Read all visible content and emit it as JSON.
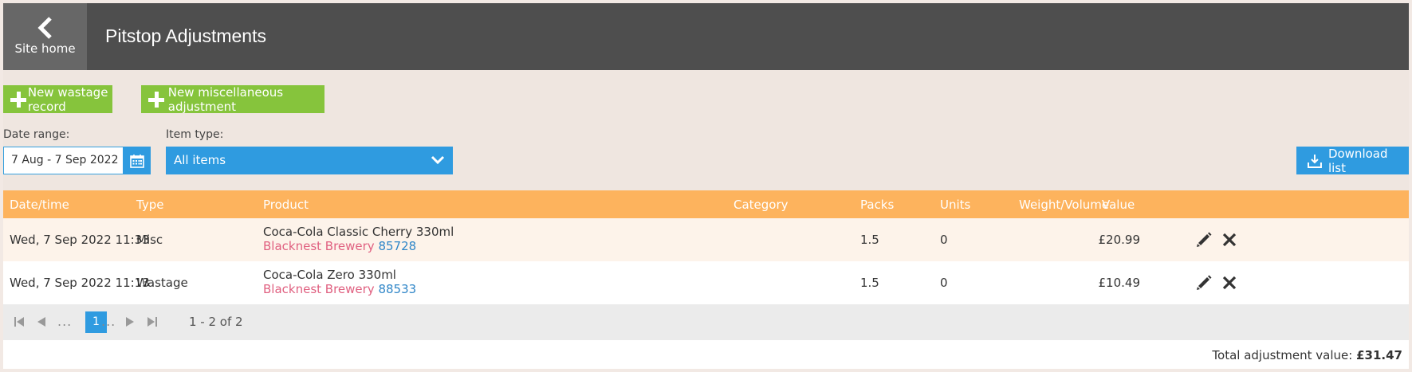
{
  "header": {
    "home_label": "Site home",
    "title": "Pitstop Adjustments"
  },
  "actions": {
    "new_wastage": "New wastage record",
    "new_misc": "New miscellaneous adjustment",
    "download": "Download list"
  },
  "filters": {
    "date_label": "Date range:",
    "date_value": "7 Aug - 7 Sep 2022",
    "type_label": "Item type:",
    "type_value": "All items"
  },
  "table": {
    "columns": [
      "Date/time",
      "Type",
      "Product",
      "Category",
      "Packs",
      "Units",
      "Weight/Volume",
      "Value"
    ],
    "rows": [
      {
        "datetime": "Wed, 7 Sep 2022 11:33",
        "type": "Misc",
        "product": "Coca-Cola Classic Cherry 330ml",
        "supplier": "Blacknest Brewery",
        "code": "85728",
        "category": "",
        "packs": "1.5",
        "units": "0",
        "weight": "",
        "value": "£20.99"
      },
      {
        "datetime": "Wed, 7 Sep 2022 11:13",
        "type": "Wastage",
        "product": "Coca-Cola Zero 330ml",
        "supplier": "Blacknest Brewery",
        "code": "88533",
        "category": "",
        "packs": "1.5",
        "units": "0",
        "weight": "",
        "value": "£10.49"
      }
    ]
  },
  "pager": {
    "current": "1",
    "dots": "...",
    "info": "1 - 2 of 2"
  },
  "footer": {
    "total_label": "Total adjustment value:",
    "total_value": "£31.47"
  },
  "colors": {
    "header_bg": "#4e4e4e",
    "green": "#86c43c",
    "blue": "#2f9be0",
    "orange": "#fdb35d"
  }
}
